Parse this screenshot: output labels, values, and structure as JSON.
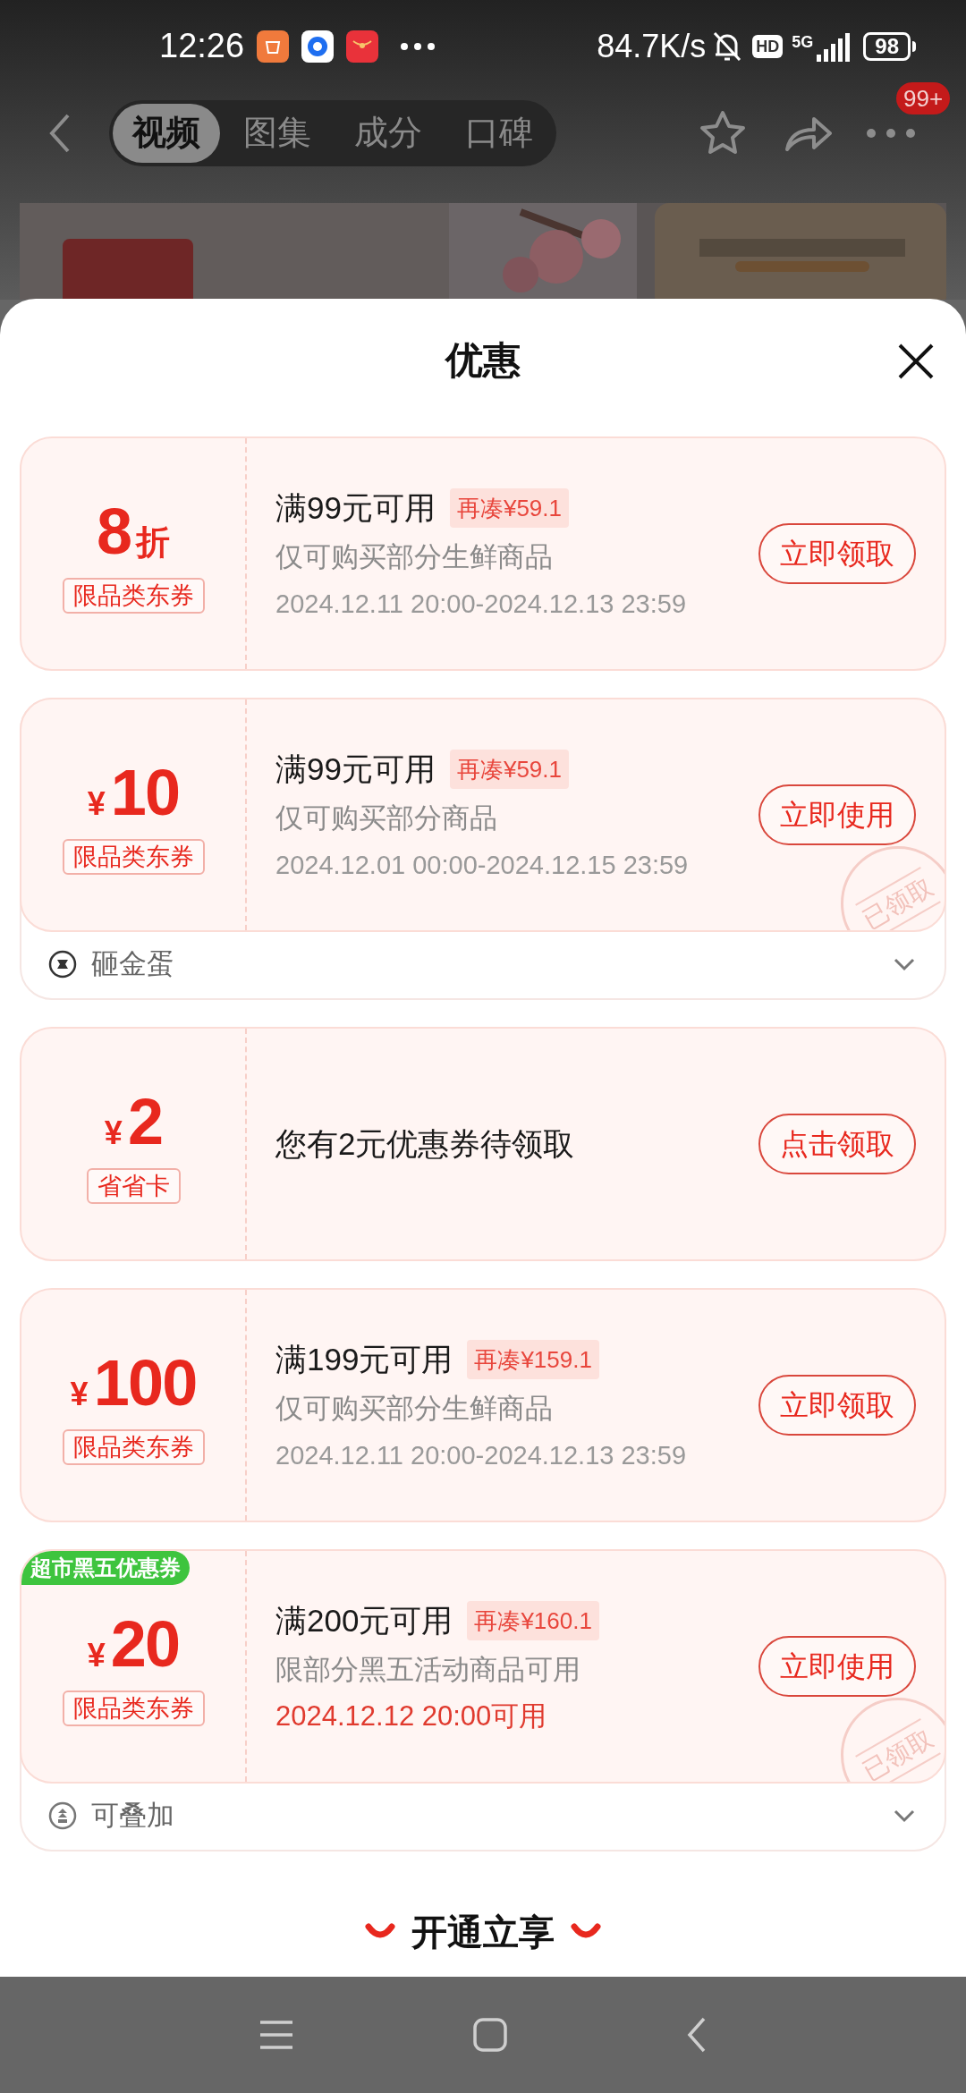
{
  "status_bar": {
    "time": "12:26",
    "network_speed": "84.7K/s",
    "hd": "HD",
    "network": "5G",
    "battery": "98"
  },
  "nav": {
    "tabs": [
      {
        "label": "视频",
        "selected": true
      },
      {
        "label": "图集",
        "selected": false
      },
      {
        "label": "成分",
        "selected": false
      },
      {
        "label": "口碑",
        "selected": false
      }
    ],
    "badge": "99+"
  },
  "sheet": {
    "title": "优惠",
    "coupons": [
      {
        "kind": "offer",
        "amount": "8",
        "unit": "折",
        "tag": "限品类东券",
        "condition": "满99元可用",
        "gap": "再凑¥59.1",
        "scope": "仅可购买部分生鲜商品",
        "validity": "2024.12.11 20:00-2024.12.13 23:59",
        "validity_highlight": false,
        "button": "立即领取"
      },
      {
        "kind": "offer",
        "currency": "¥",
        "amount": "10",
        "tag": "限品类东券",
        "condition": "满99元可用",
        "gap": "再凑¥59.1",
        "scope": "仅可购买部分商品",
        "validity": "2024.12.01 00:00-2024.12.15 23:59",
        "validity_highlight": false,
        "button": "立即使用",
        "stamp": "已领取",
        "extra": {
          "kind": "egg",
          "label": "砸金蛋",
          "expanded": false
        }
      },
      {
        "kind": "message",
        "currency": "¥",
        "amount": "2",
        "tag": "省省卡",
        "message": "您有2元优惠券待领取",
        "button": "点击领取"
      },
      {
        "kind": "offer",
        "currency": "¥",
        "amount": "100",
        "tag": "限品类东券",
        "condition": "满199元可用",
        "gap": "再凑¥159.1",
        "scope": "仅可购买部分生鲜商品",
        "validity": "2024.12.11 20:00-2024.12.13 23:59",
        "validity_highlight": false,
        "button": "立即领取"
      },
      {
        "kind": "offer",
        "corner_label": "超市黑五优惠券",
        "currency": "¥",
        "amount": "20",
        "tag": "限品类东券",
        "condition": "满200元可用",
        "gap": "再凑¥160.1",
        "scope": "限部分黑五活动商品可用",
        "validity": "2024.12.12 20:00可用",
        "validity_highlight": true,
        "button": "立即使用",
        "stamp": "已领取",
        "extra": {
          "kind": "stack",
          "label": "可叠加",
          "expanded": false
        }
      }
    ],
    "footer_action": "开通立享"
  }
}
